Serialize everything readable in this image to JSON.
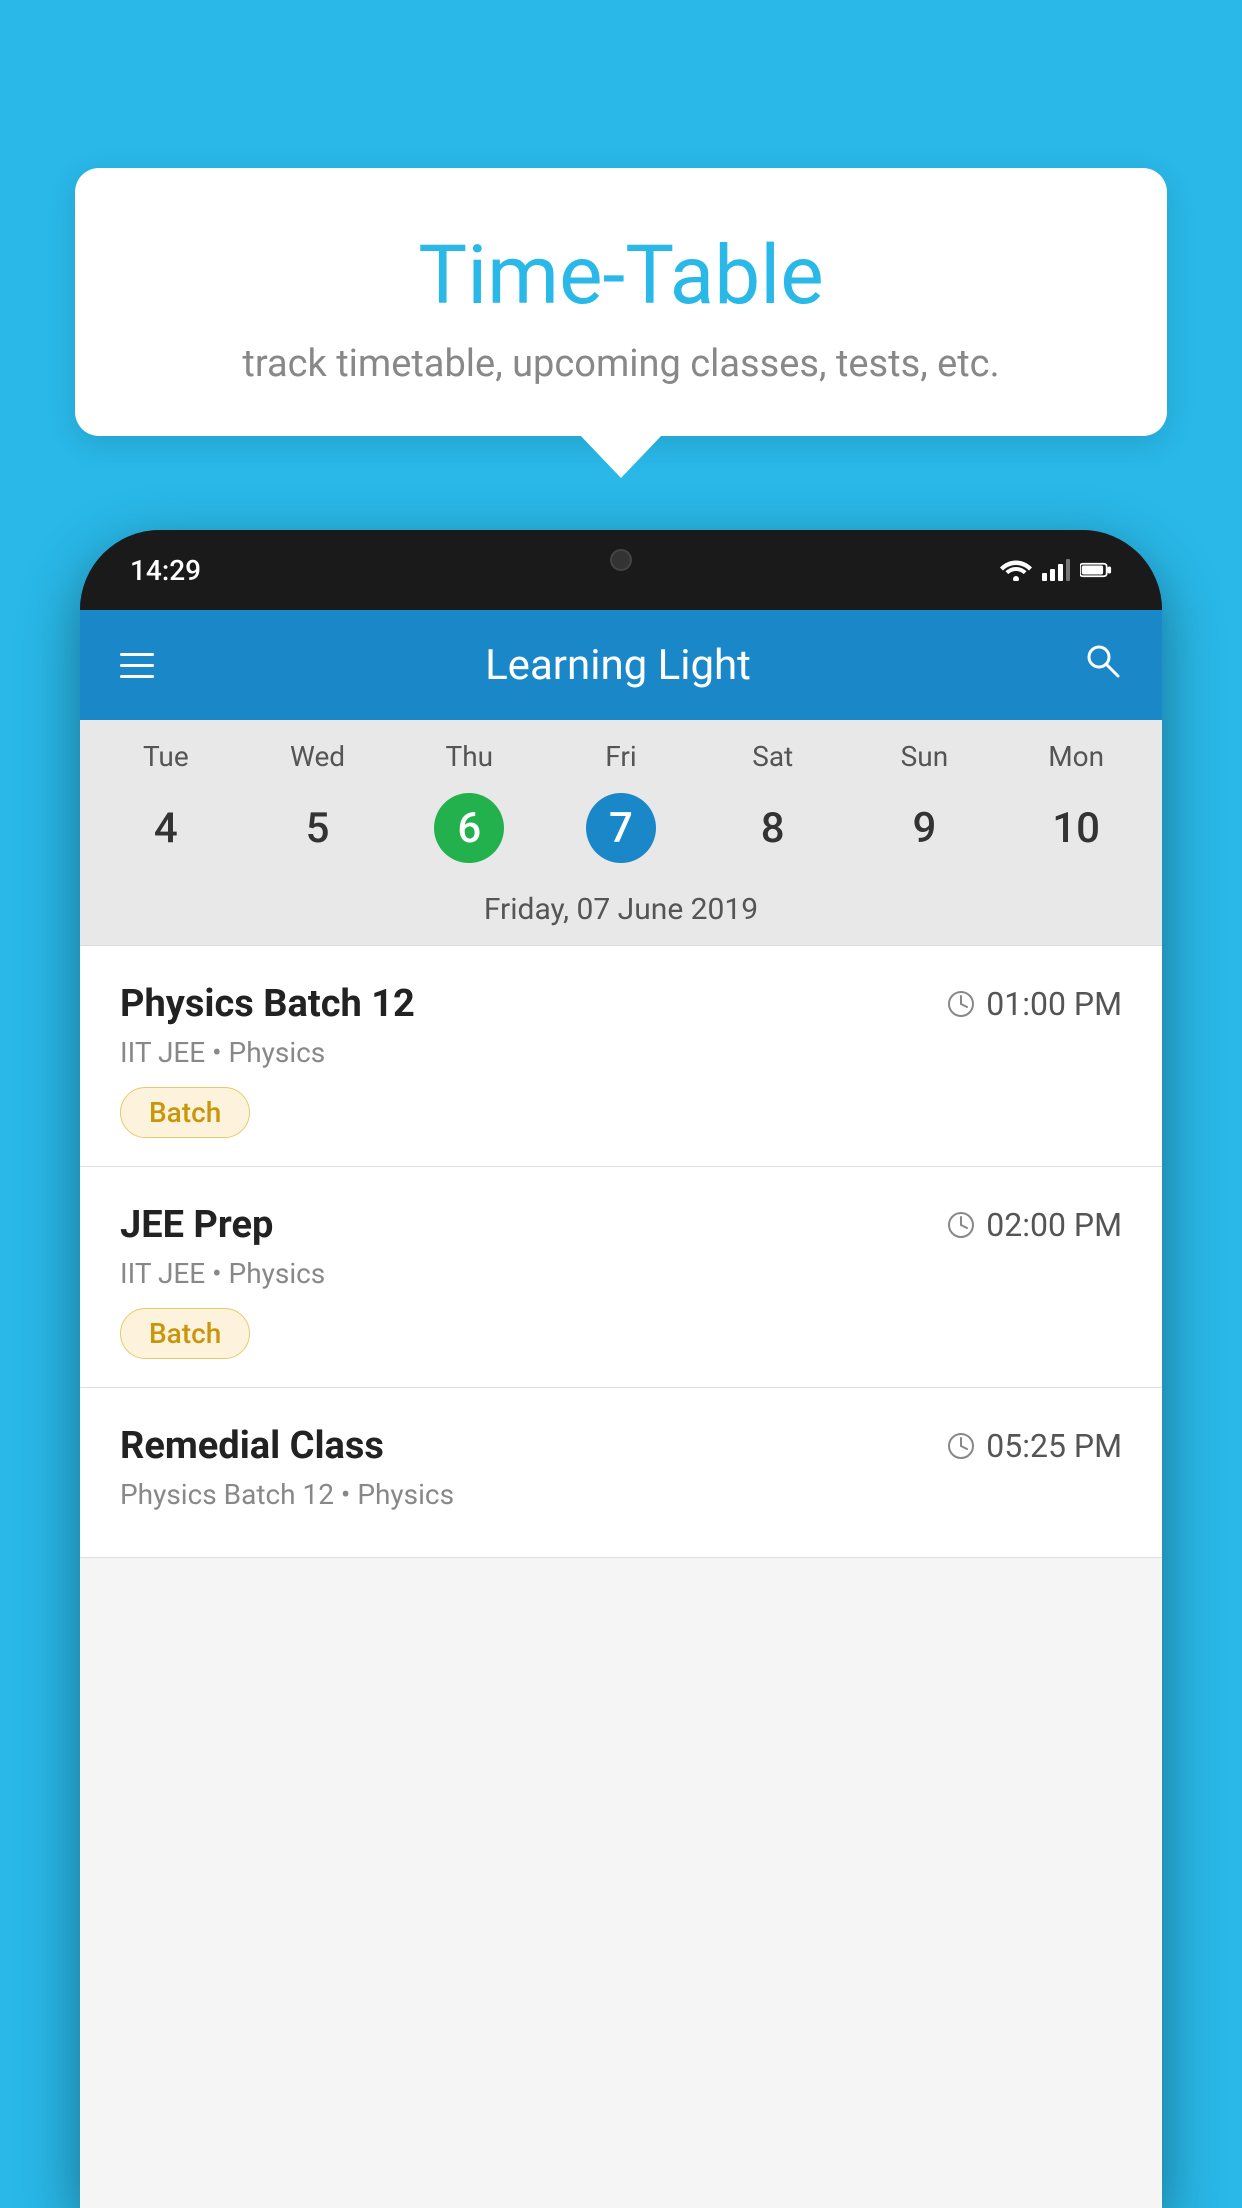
{
  "background_color": "#29b8e8",
  "tooltip": {
    "title": "Time-Table",
    "subtitle": "track timetable, upcoming classes, tests, etc."
  },
  "phone": {
    "status_bar": {
      "time": "14:29",
      "icons": [
        "wifi",
        "signal",
        "battery"
      ]
    },
    "app_bar": {
      "title": "Learning Light",
      "menu_icon_label": "menu",
      "search_icon_label": "search"
    },
    "calendar": {
      "days": [
        "Tue",
        "Wed",
        "Thu",
        "Fri",
        "Sat",
        "Sun",
        "Mon"
      ],
      "dates": [
        "4",
        "5",
        "6",
        "7",
        "8",
        "9",
        "10"
      ],
      "today_index": 2,
      "selected_index": 3,
      "selected_date_label": "Friday, 07 June 2019"
    },
    "schedule_items": [
      {
        "title": "Physics Batch 12",
        "time": "01:00 PM",
        "subtitle": "IIT JEE • Physics",
        "badge": "Batch"
      },
      {
        "title": "JEE Prep",
        "time": "02:00 PM",
        "subtitle": "IIT JEE • Physics",
        "badge": "Batch"
      },
      {
        "title": "Remedial Class",
        "time": "05:25 PM",
        "subtitle": "Physics Batch 12 • Physics",
        "badge": null
      }
    ]
  }
}
